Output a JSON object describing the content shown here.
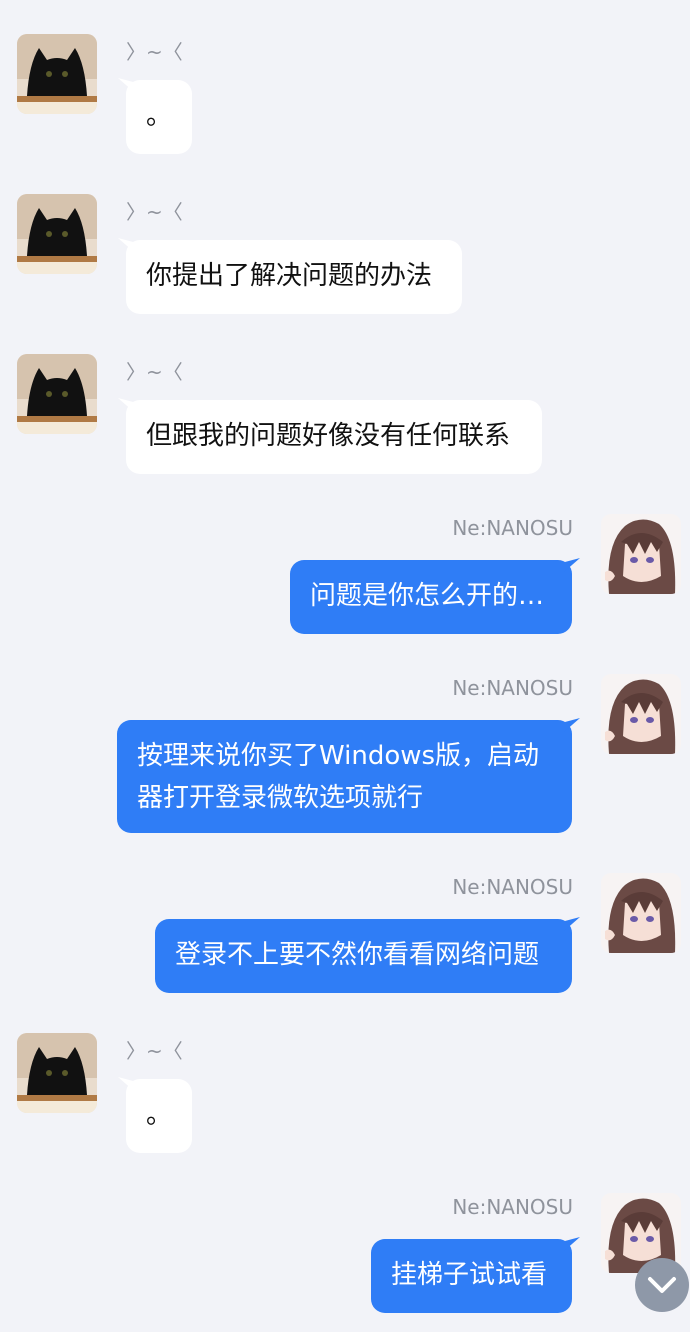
{
  "contacts": {
    "left_name": "〉~〈",
    "right_name": "Ne:NANOSU"
  },
  "messages": [
    {
      "side": "in",
      "text": "。"
    },
    {
      "side": "in",
      "text": "你提出了解决问题的办法"
    },
    {
      "side": "in",
      "text": "但跟我的问题好像没有任何联系"
    },
    {
      "side": "out",
      "text": "问题是你怎么开的…"
    },
    {
      "side": "out",
      "text": "按理来说你买了Windows版，启动器打开登录微软选项就行"
    },
    {
      "side": "out",
      "text": "登录不上要不然你看看网络问题"
    },
    {
      "side": "in",
      "text": "。"
    },
    {
      "side": "out",
      "text": "挂梯子试试看"
    }
  ],
  "icons": {
    "scroll_down": "chevron-down-icon",
    "left_avatar": "black-cat-avatar",
    "right_avatar": "anime-girl-avatar"
  },
  "colors": {
    "background": "#f2f3f8",
    "incoming_bubble": "#ffffff",
    "outgoing_bubble": "#2f7df6",
    "scroll_button": "#8e98a8"
  }
}
